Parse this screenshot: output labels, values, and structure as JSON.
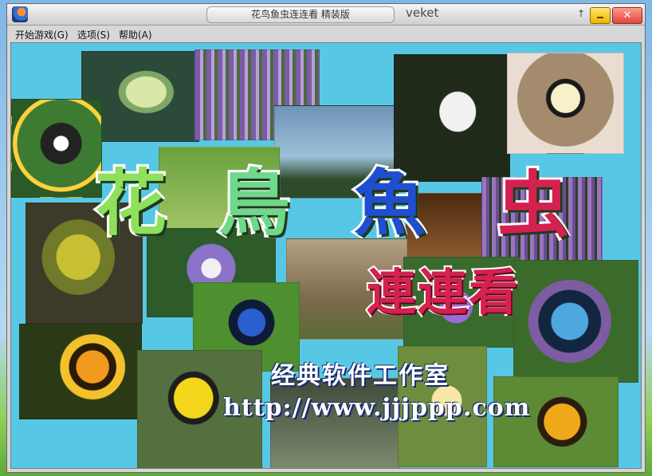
{
  "window": {
    "title": "花鸟鱼虫连连看 精装版",
    "desktop_label": "veket",
    "scroll_up_glyph": "↑",
    "minimize_glyph": "▁",
    "close_glyph": "✕"
  },
  "menu": {
    "items": [
      "开始游戏(G)",
      "选项(S)",
      "帮助(A)"
    ]
  },
  "splash": {
    "logo_chars": [
      "花",
      "鳥",
      "魚",
      "虫"
    ],
    "subtitle": "連連看",
    "studio": "经典软件工作室",
    "url": "http://www.jjjppp.com"
  },
  "colors": {
    "client_bg": "#56c8e6",
    "logo_green": "#8fe05a",
    "logo_blue": "#1f4fd0",
    "logo_red": "#d4214f"
  }
}
